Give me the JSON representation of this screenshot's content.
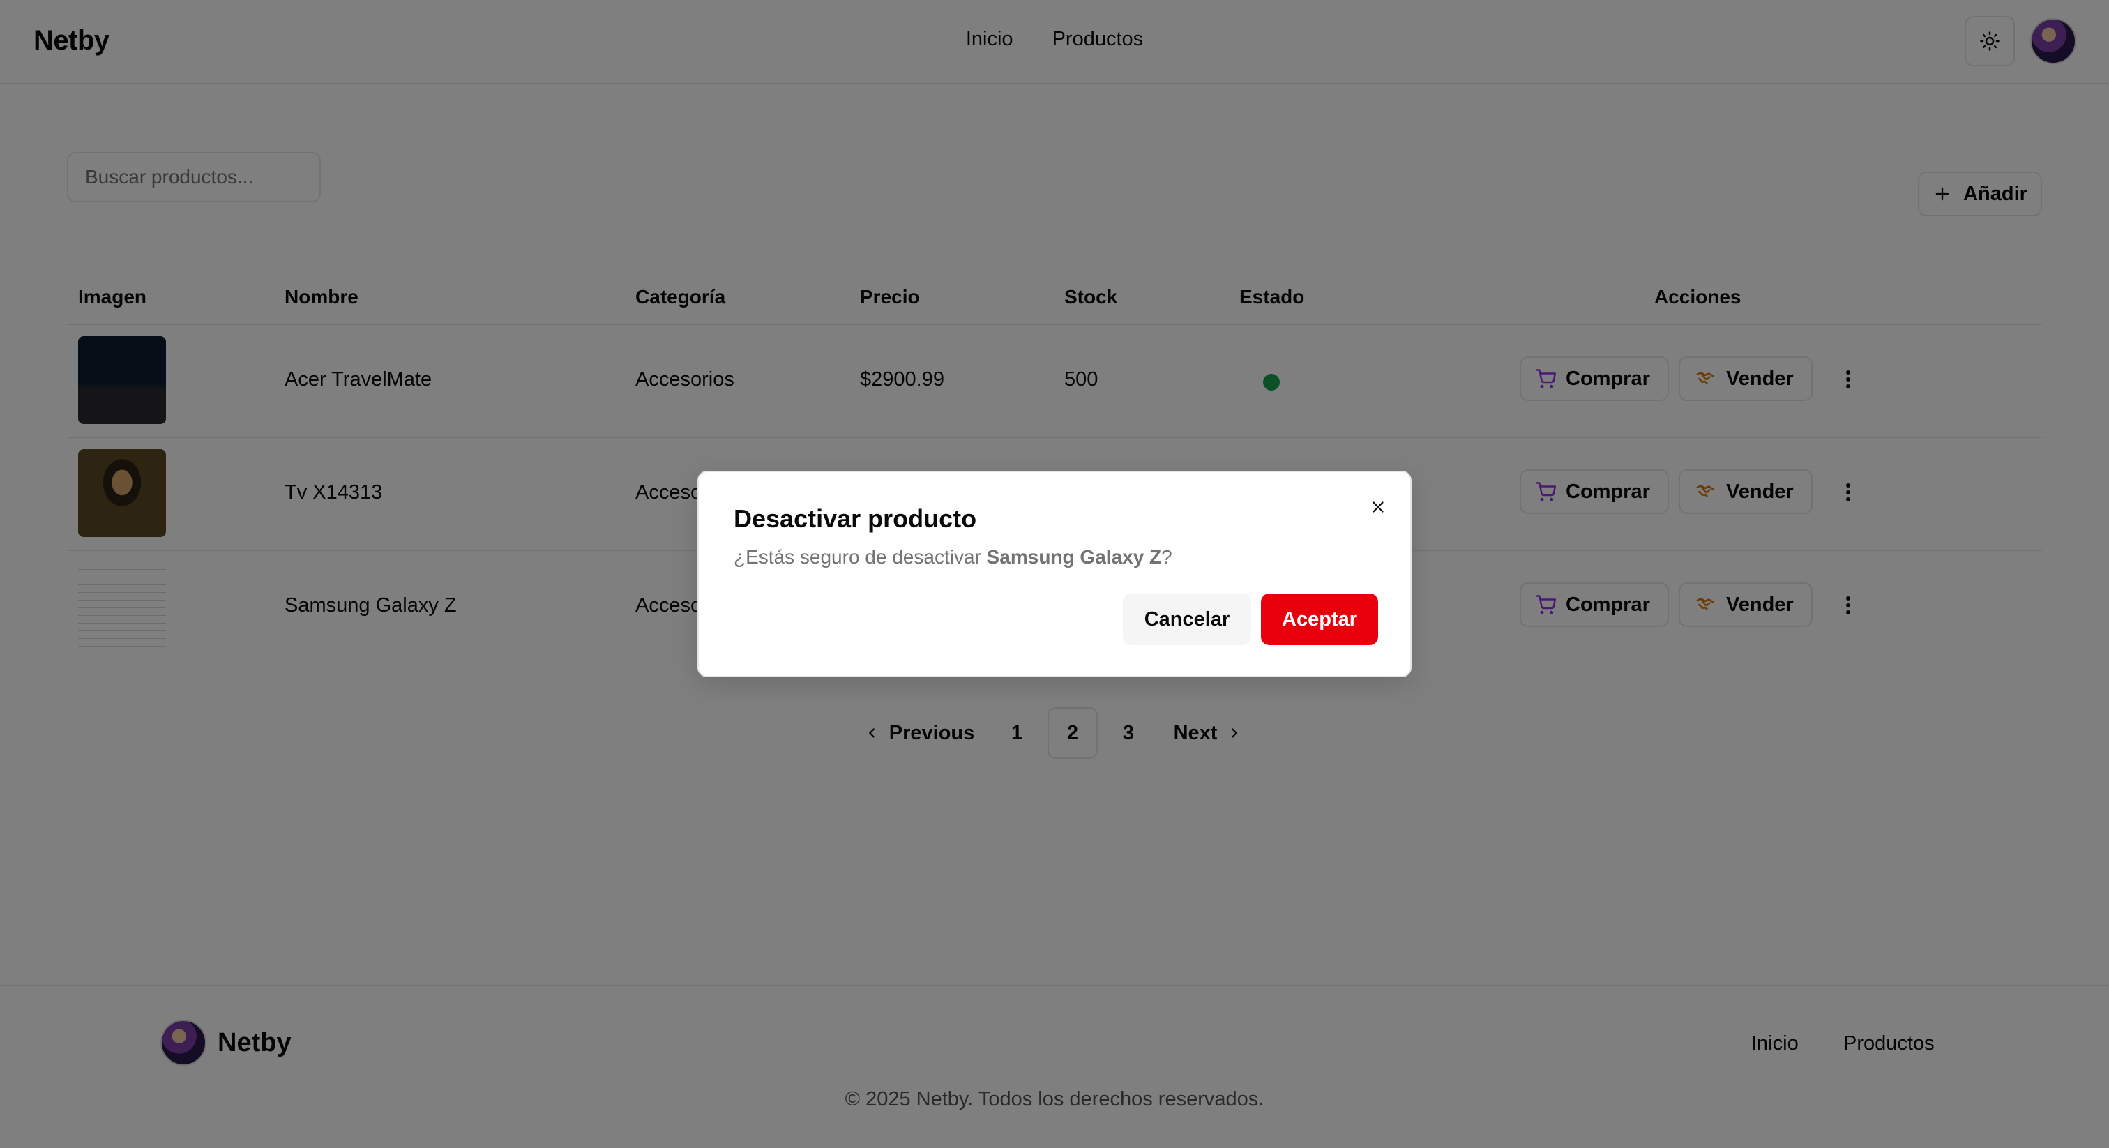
{
  "header": {
    "brand": "Netby",
    "nav": [
      "Inicio",
      "Productos"
    ],
    "theme_icon": "sun-icon",
    "avatar_icon": "user-avatar"
  },
  "toolbar": {
    "search_placeholder": "Buscar productos...",
    "add_label": "Añadir",
    "add_icon": "plus-icon"
  },
  "table": {
    "columns": [
      "Imagen",
      "Nombre",
      "Categoría",
      "Precio",
      "Stock",
      "Estado",
      "Acciones"
    ],
    "rows": [
      {
        "image_icon": "laptop-thumbnail",
        "name": "Acer TravelMate",
        "category": "Accesorios",
        "price": "$2900.99",
        "stock": "500",
        "status": "active"
      },
      {
        "image_icon": "mona-lisa-thumbnail",
        "name": "Tv X14313",
        "category": "Accesorios",
        "price": "",
        "stock": "",
        "status": ""
      },
      {
        "image_icon": "document-thumbnail",
        "name": "Samsung Galaxy Z",
        "category": "Accesorios",
        "price": "",
        "stock": "",
        "status": ""
      }
    ],
    "buy_label": "Comprar",
    "sell_label": "Vender",
    "status_color": "#16a34a"
  },
  "pagination": {
    "previous": "Previous",
    "pages": [
      "1",
      "2",
      "3"
    ],
    "current": "2",
    "next": "Next"
  },
  "footer": {
    "brand": "Netby",
    "nav": [
      "Inicio",
      "Productos"
    ],
    "copyright": "© 2025 Netby. Todos los derechos reservados."
  },
  "modal": {
    "title": "Desactivar producto",
    "message_prefix": "¿Estás seguro de desactivar ",
    "message_product": "Samsung Galaxy Z",
    "message_suffix": "?",
    "cancel_label": "Cancelar",
    "accept_label": "Aceptar",
    "accept_color": "#e7000b"
  }
}
